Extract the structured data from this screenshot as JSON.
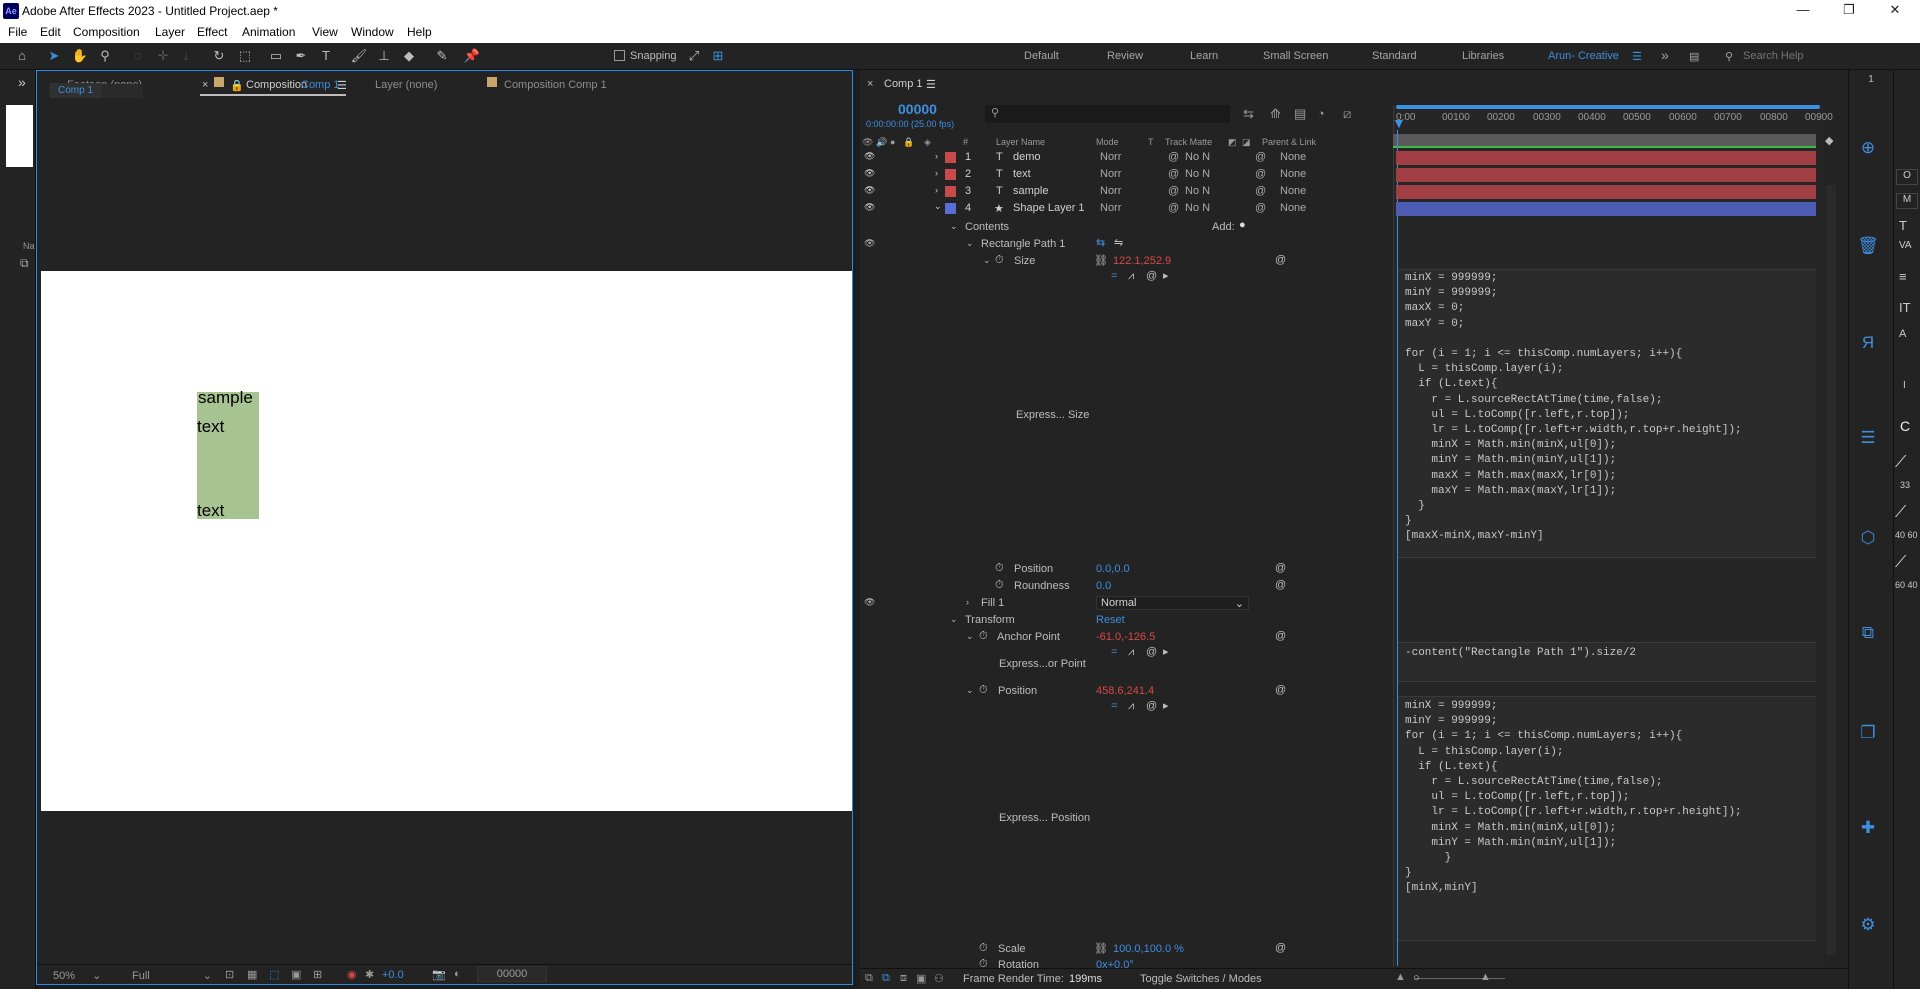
{
  "window": {
    "title": "Adobe After Effects 2023 - Untitled Project.aep *",
    "app_icon": "Ae",
    "controls": [
      "—",
      "❐",
      "✕"
    ]
  },
  "menu": [
    "File",
    "Edit",
    "Composition",
    "Layer",
    "Effect",
    "Animation",
    "View",
    "Window",
    "Help"
  ],
  "toolbar": {
    "snapping_label": "Snapping",
    "workspaces": [
      "Default",
      "Review",
      "Learn",
      "Small Screen",
      "Standard",
      "Libraries",
      "Arun- Creative"
    ],
    "active_workspace": "Arun- Creative",
    "overflow": "»",
    "search_placeholder": "Search Help"
  },
  "comp_panel": {
    "tabs": [
      "Footage (none)",
      "Composition",
      "Comp 1",
      "Layer (none)",
      "Composition Comp 1"
    ],
    "breadcrumb": "Comp 1",
    "canvas_text": {
      "top": "sample",
      "mid": "text",
      "bottom": "text"
    },
    "footer": {
      "zoom": "50%",
      "resolution": "Full",
      "exposure": "+0.0",
      "timecode": "00000"
    }
  },
  "left_strip": {
    "expand": "»",
    "name_header": "Na"
  },
  "timeline": {
    "tab": "Comp 1",
    "current_time": "00000",
    "time_sub": "0:00:00:00 (25.00 fps)",
    "search_placeholder": "",
    "headers": {
      "layer_name": "Layer Name",
      "mode": "Mode",
      "t": "T",
      "track_matte": "Track Matte",
      "parent": "Parent & Link",
      "num": "#"
    },
    "layers": [
      {
        "num": "1",
        "type": "T",
        "name": "demo",
        "mode": "Norr",
        "matte": "No N",
        "parent": "None",
        "color": "#c84a4a"
      },
      {
        "num": "2",
        "type": "T",
        "name": "text",
        "mode": "Norr",
        "matte": "No N",
        "parent": "None",
        "color": "#c84a4a"
      },
      {
        "num": "3",
        "type": "T",
        "name": "sample",
        "mode": "Norr",
        "matte": "No N",
        "parent": "None",
        "color": "#c84a4a"
      },
      {
        "num": "4",
        "type": "★",
        "name": "Shape Layer 1",
        "mode": "Norr",
        "matte": "No N",
        "parent": "None",
        "color": "#5a6fd6"
      }
    ],
    "ruler": [
      "0:00",
      "00100",
      "00200",
      "00300",
      "00400",
      "00500",
      "00600",
      "00700",
      "00800",
      "00900"
    ],
    "props": {
      "contents": "Contents",
      "add": "Add:",
      "rect_path": "Rectangle Path 1",
      "size": "Size",
      "size_val": "122.1,252.9",
      "express_size": "Express... Size",
      "position": "Position",
      "position_val": "0.0,0.0",
      "roundness": "Roundness",
      "roundness_val": "0.0",
      "fill": "Fill 1",
      "fill_mode": "Normal",
      "transform": "Transform",
      "reset": "Reset",
      "anchor": "Anchor Point",
      "anchor_val": "-61.0,-126.5",
      "express_anchor": "Express...or Point",
      "pos2": "Position",
      "pos2_val": "458.6,241.4",
      "express_pos": "Express... Position",
      "scale": "Scale",
      "scale_val": "100.0,100.0 %",
      "rotation": "Rotation",
      "rotation_val": "0x+0.0°"
    },
    "code_size": "minX = 999999;\nminY = 999999;\nmaxX = 0;\nmaxY = 0;\n\nfor (i = 1; i <= thisComp.numLayers; i++){\n  L = thisComp.layer(i);\n  if (L.text){\n    r = L.sourceRectAtTime(time,false);\n    ul = L.toComp([r.left,r.top]);\n    lr = L.toComp([r.left+r.width,r.top+r.height]);\n    minX = Math.min(minX,ul[0]);\n    minY = Math.min(minY,ul[1]);\n    maxX = Math.max(maxX,lr[0]);\n    maxY = Math.max(maxY,lr[1]);\n  }\n}\n[maxX-minX,maxY-minY]",
    "code_anchor": "-content(\"Rectangle Path 1\").size/2",
    "code_position": "minX = 999999;\nminY = 999999;\nfor (i = 1; i <= thisComp.numLayers; i++){\n  L = thisComp.layer(i);\n  if (L.text){\n    r = L.sourceRectAtTime(time,false);\n    ul = L.toComp([r.left,r.top]);\n    lr = L.toComp([r.left+r.width,r.top+r.height]);\n    minX = Math.min(minX,ul[0]);\n    minY = Math.min(minY,ul[1]);\n      }\n}\n[minX,minY]",
    "footer": {
      "render_label": "Frame Render Time:",
      "render_time": "199ms",
      "toggle": "Toggle Switches / Modes"
    }
  },
  "right_strip": {
    "far_labels": [
      "O",
      "M",
      "C",
      "33",
      "40 60",
      "60 40"
    ]
  },
  "colors": {
    "accent": "#2d8ceb",
    "shape_bbox": "#a8c392",
    "layer_text_bar": "#a23f45",
    "layer_shape_bar": "#4d5db3"
  }
}
